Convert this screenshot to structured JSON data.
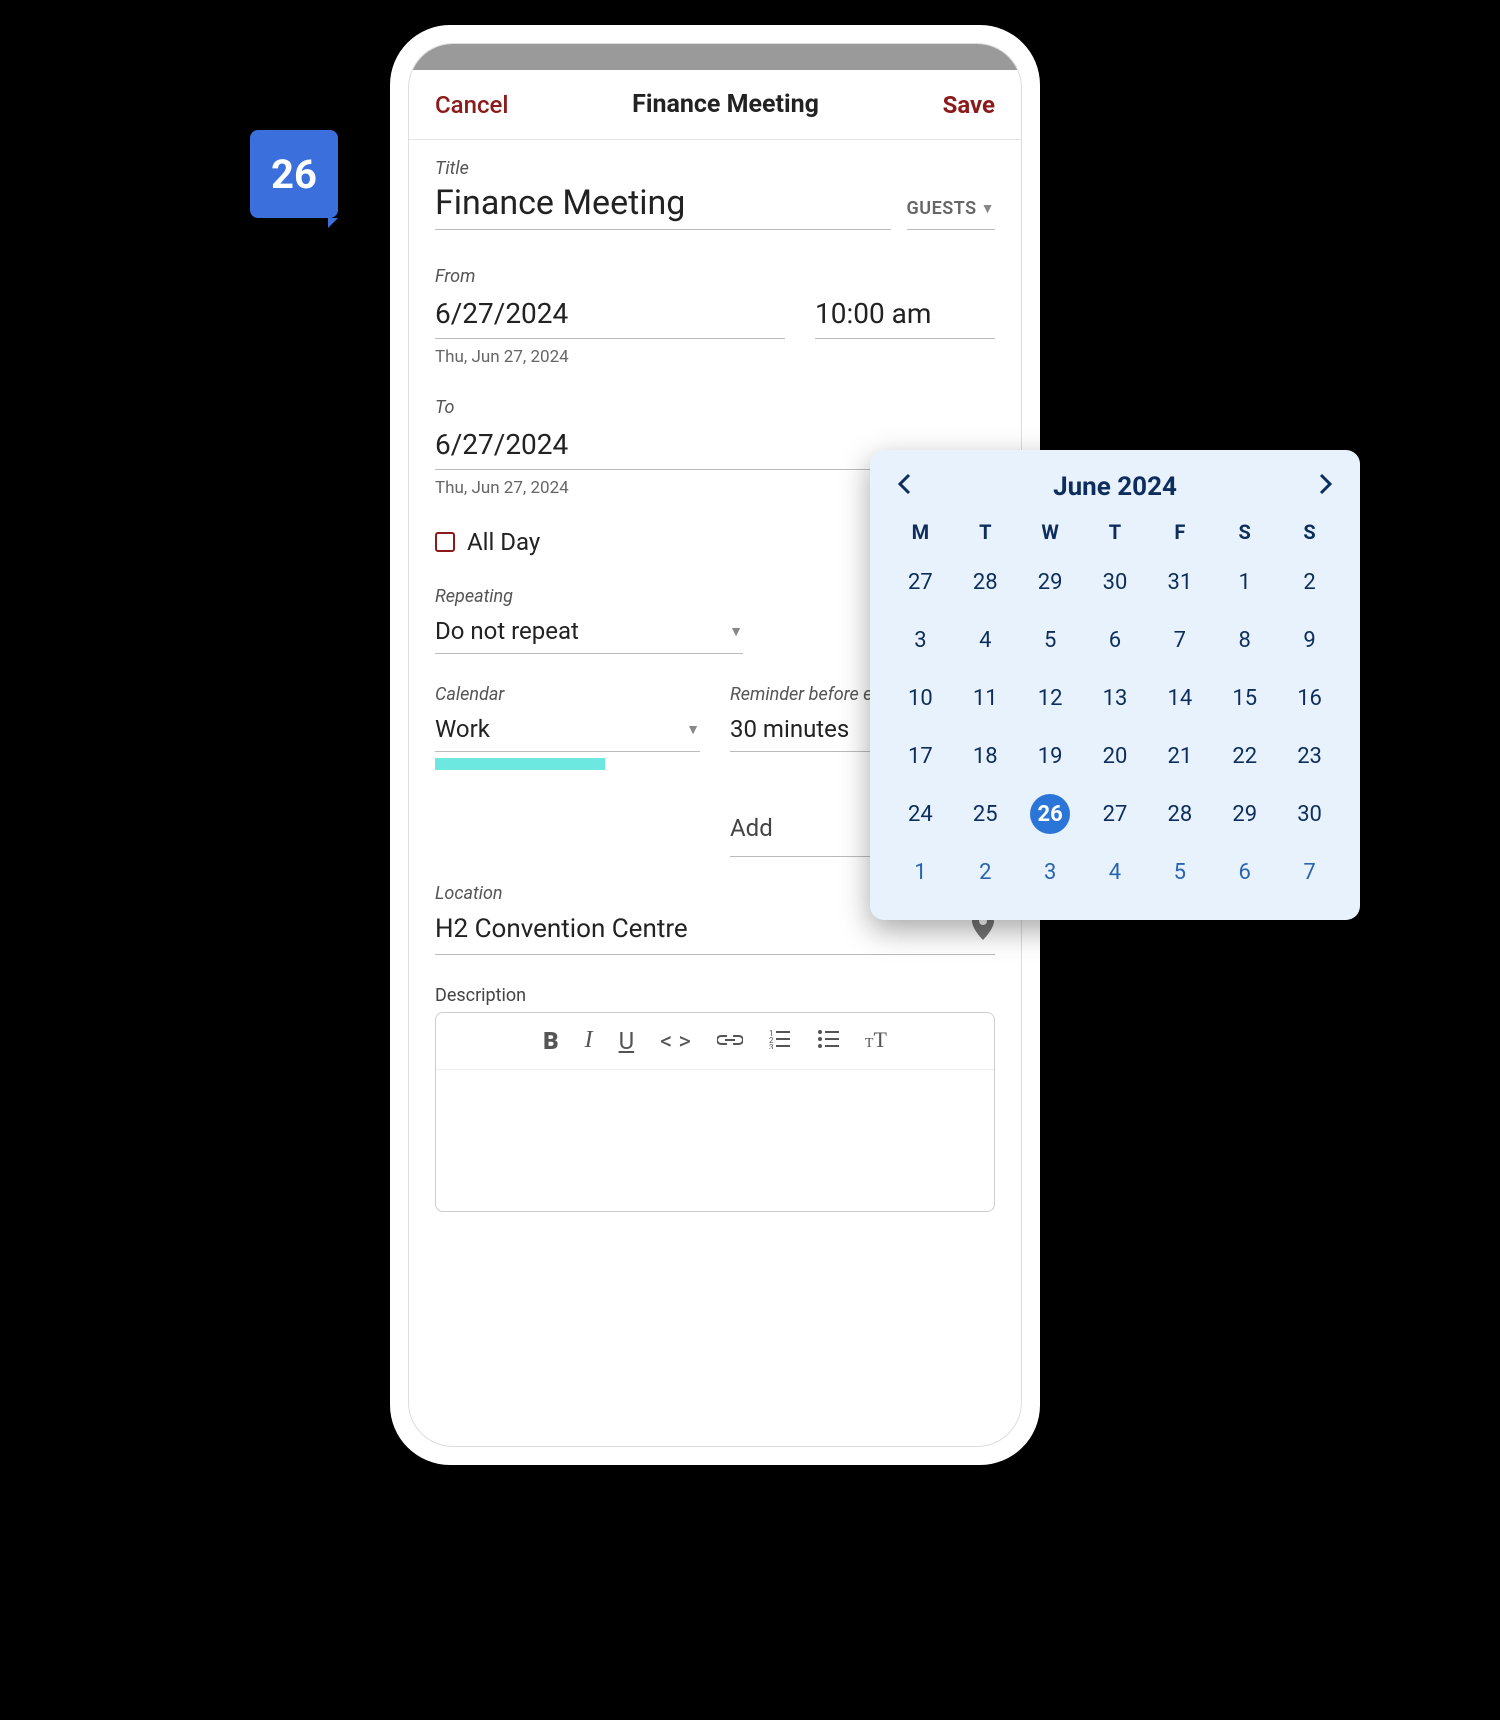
{
  "badge": {
    "day": "26"
  },
  "header": {
    "cancel": "Cancel",
    "title": "Finance Meeting",
    "save": "Save"
  },
  "title_field": {
    "label": "Title",
    "value": "Finance Meeting",
    "guests_label": "GUESTS"
  },
  "from": {
    "label": "From",
    "date": "6/27/2024",
    "time": "10:00 am",
    "sub": "Thu, Jun 27, 2024"
  },
  "to": {
    "label": "To",
    "date": "6/27/2024",
    "sub": "Thu, Jun 27, 2024"
  },
  "allday": {
    "label": "All Day",
    "checked": false
  },
  "repeating": {
    "label": "Repeating",
    "value": "Do not repeat"
  },
  "calendar": {
    "label": "Calendar",
    "value": "Work",
    "color": "#6de8e0"
  },
  "reminder": {
    "label": "Reminder before event",
    "value": "30 minutes"
  },
  "add": {
    "label": "Add"
  },
  "location": {
    "label": "Location",
    "value": "H2 Convention Centre"
  },
  "description": {
    "label": "Description"
  },
  "picker": {
    "month": "June 2024",
    "dow": [
      "M",
      "T",
      "W",
      "T",
      "F",
      "S",
      "S"
    ],
    "leading": [
      27,
      28,
      29,
      30,
      31
    ],
    "days": [
      1,
      2,
      3,
      4,
      5,
      6,
      7,
      8,
      9,
      10,
      11,
      12,
      13,
      14,
      15,
      16,
      17,
      18,
      19,
      20,
      21,
      22,
      23,
      24,
      25,
      26,
      27,
      28,
      29,
      30
    ],
    "trailing": [
      1,
      2,
      3,
      4,
      5,
      6,
      7
    ],
    "selected": 26
  }
}
